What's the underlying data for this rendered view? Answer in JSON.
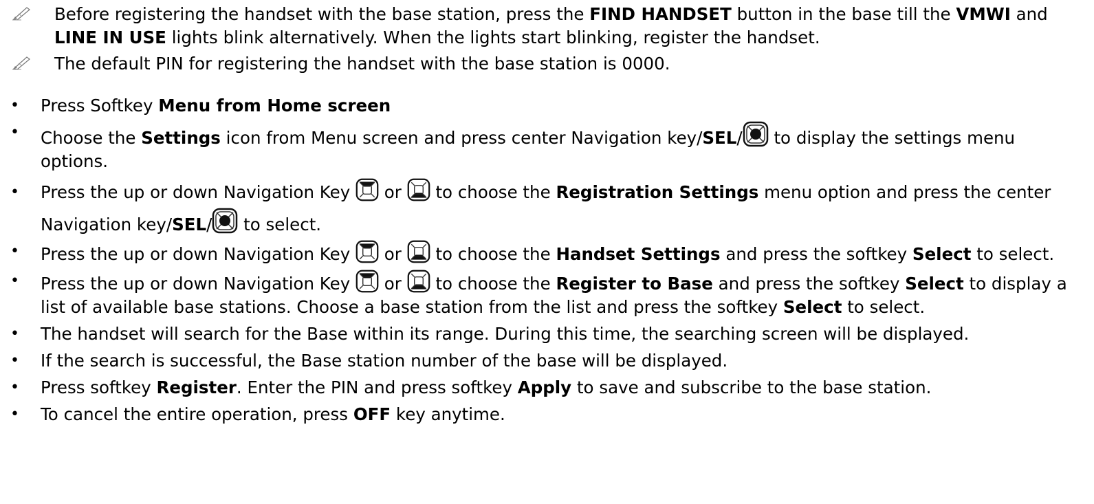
{
  "notes": [
    {
      "segments": [
        {
          "t": "Before registering the handset with the base station, press the ",
          "b": false
        },
        {
          "t": "FIND HANDSET",
          "b": true
        },
        {
          "t": " button in the base till the ",
          "b": false
        },
        {
          "t": "VMWI",
          "b": true
        },
        {
          "t": " and ",
          "b": false
        },
        {
          "t": "LINE IN USE",
          "b": true
        },
        {
          "t": " lights blink alternatively. When the lights start blinking, register the handset.",
          "b": false
        }
      ]
    },
    {
      "segments": [
        {
          "t": "The default PIN for registering the handset with the base station is 0000.",
          "b": false
        }
      ]
    }
  ],
  "steps": [
    {
      "a": "Press Softkey ",
      "b1": "Menu from Home screen",
      "c": ""
    },
    {
      "a": "Choose the ",
      "b1": "Settings",
      "c": " icon from Menu screen and press center Navigation key/",
      "b2": "SEL",
      "d": "/",
      "e": " to display the settings menu options."
    },
    {
      "a": "Press the up or down Navigation Key ",
      "or": " or ",
      "c": "  to choose the ",
      "b1": "Registration Settings",
      "d": " menu option and press the center Navigation key/",
      "b2": "SEL",
      "e": "/",
      "f": "  to select."
    },
    {
      "a": "Press the up or down Navigation Key ",
      "or": " or ",
      "c": "  to choose the ",
      "b1": "Handset Settings",
      "d": " and press the softkey ",
      "b2": "Select",
      "e": " to select."
    },
    {
      "a": "Press the up or down Navigation Key ",
      "or": " or ",
      "c": "  to choose the ",
      "b1": "Register to Base",
      "d": " and press the softkey ",
      "b2": "Select",
      "e": " to display a list of available base stations. Choose a base station from the list and press the softkey ",
      "b3": "Select",
      "f": " to select."
    },
    {
      "a": "The handset will search for the Base within its range. During this time, the searching screen will be displayed."
    },
    {
      "a": "If the search is successful, the Base station number of the base will be displayed."
    },
    {
      "a": "Press softkey ",
      "b1": "Register",
      "c": ". Enter the PIN and press softkey ",
      "b2": "Apply",
      "d": " to save and subscribe to the base station."
    },
    {
      "a": "To cancel the entire operation, press ",
      "b1": "OFF",
      "c": " key anytime."
    }
  ],
  "bullet_char": "•",
  "icons": {
    "note": "pencil-note-icon",
    "center": "center-navigation-key-icon",
    "up": "up-navigation-key-icon",
    "down": "down-navigation-key-icon"
  }
}
